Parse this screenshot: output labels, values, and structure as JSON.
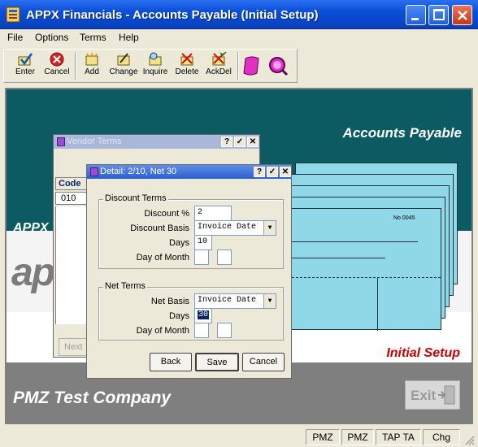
{
  "window": {
    "title": "APPX Financials - Accounts Payable (Initial Setup)"
  },
  "menu": {
    "items": [
      "File",
      "Options",
      "Terms",
      "Help"
    ]
  },
  "toolbar": {
    "buttons": [
      "Enter",
      "Cancel",
      "Add",
      "Change",
      "Inquire",
      "Delete",
      "AckDel"
    ]
  },
  "background": {
    "heading": "Accounts Payable",
    "brand_small": "APPX",
    "brand_logo": "ap",
    "subheading": "Initial Setup",
    "company": "PMZ Test Company",
    "exit_label": "Exit"
  },
  "vendor_terms": {
    "title": "Vendor Terms",
    "column_code": "Code",
    "code_value": "010",
    "next_label": "Next"
  },
  "detail": {
    "title": "Detail: 2/10, Net 30",
    "discount_group": "Discount Terms",
    "discount_pct_label": "Discount %",
    "discount_pct_value": "2",
    "discount_basis_label": "Discount Basis",
    "discount_basis_value": "Invoice Date",
    "discount_days_label": "Days",
    "discount_days_value": "10",
    "discount_dom_label": "Day of Month",
    "net_group": "Net Terms",
    "net_basis_label": "Net Basis",
    "net_basis_value": "Invoice Date",
    "net_days_label": "Days",
    "net_days_value": "30",
    "net_dom_label": "Day of Month",
    "back_label": "Back",
    "save_label": "Save",
    "cancel_label": "Cancel"
  },
  "status": {
    "cells": [
      "PMZ",
      "PMZ",
      "TAP TA",
      "Chg"
    ]
  },
  "colors": {
    "title_blue": "#0a4fd9",
    "teal": "#0c5a62",
    "accent_red": "#cc0000"
  }
}
